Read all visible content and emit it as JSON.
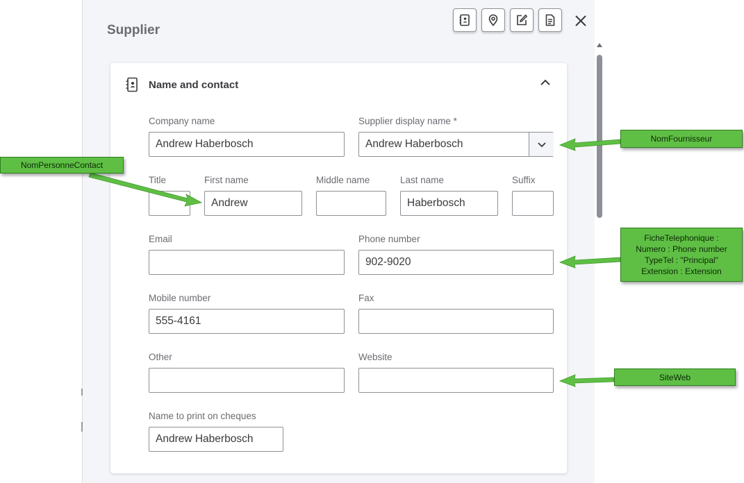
{
  "panel": {
    "title": "Supplier"
  },
  "toolbar": {
    "icons": [
      "contact-book-icon",
      "location-pin-icon",
      "edit-note-icon",
      "document-icon",
      "close-icon"
    ]
  },
  "section": {
    "title": "Name and contact",
    "icon": "contact-book-icon",
    "toggle_icon": "chevron-up-icon"
  },
  "fields": {
    "company_name": {
      "label": "Company name",
      "value": "Andrew Haberbosch"
    },
    "display_name": {
      "label": "Supplier display name *",
      "value": "Andrew Haberbosch"
    },
    "title": {
      "label": "Title",
      "value": ""
    },
    "first_name": {
      "label": "First name",
      "value": "Andrew"
    },
    "middle_name": {
      "label": "Middle name",
      "value": ""
    },
    "last_name": {
      "label": "Last name",
      "value": "Haberbosch"
    },
    "suffix": {
      "label": "Suffix",
      "value": ""
    },
    "email": {
      "label": "Email",
      "value": ""
    },
    "phone": {
      "label": "Phone number",
      "value": "902-9020"
    },
    "mobile": {
      "label": "Mobile number",
      "value": "555-4161"
    },
    "fax": {
      "label": "Fax",
      "value": ""
    },
    "other": {
      "label": "Other",
      "value": ""
    },
    "website": {
      "label": "Website",
      "value": ""
    },
    "cheque_name": {
      "label": "Name to print on cheques",
      "value": "Andrew Haberbosch"
    }
  },
  "callouts": {
    "contact_person": "NomPersonneContact",
    "supplier_name": "NomFournisseur",
    "phone_line1": "FicheTelephonique :",
    "phone_line2": "Numero : Phone number",
    "phone_line3": "TypeTel : \"Principal\"",
    "phone_line4": "Extension : Extension",
    "website": "SiteWeb"
  },
  "colors": {
    "callout_green": "#5fbf45",
    "arrow_green": "#5fbf45"
  }
}
